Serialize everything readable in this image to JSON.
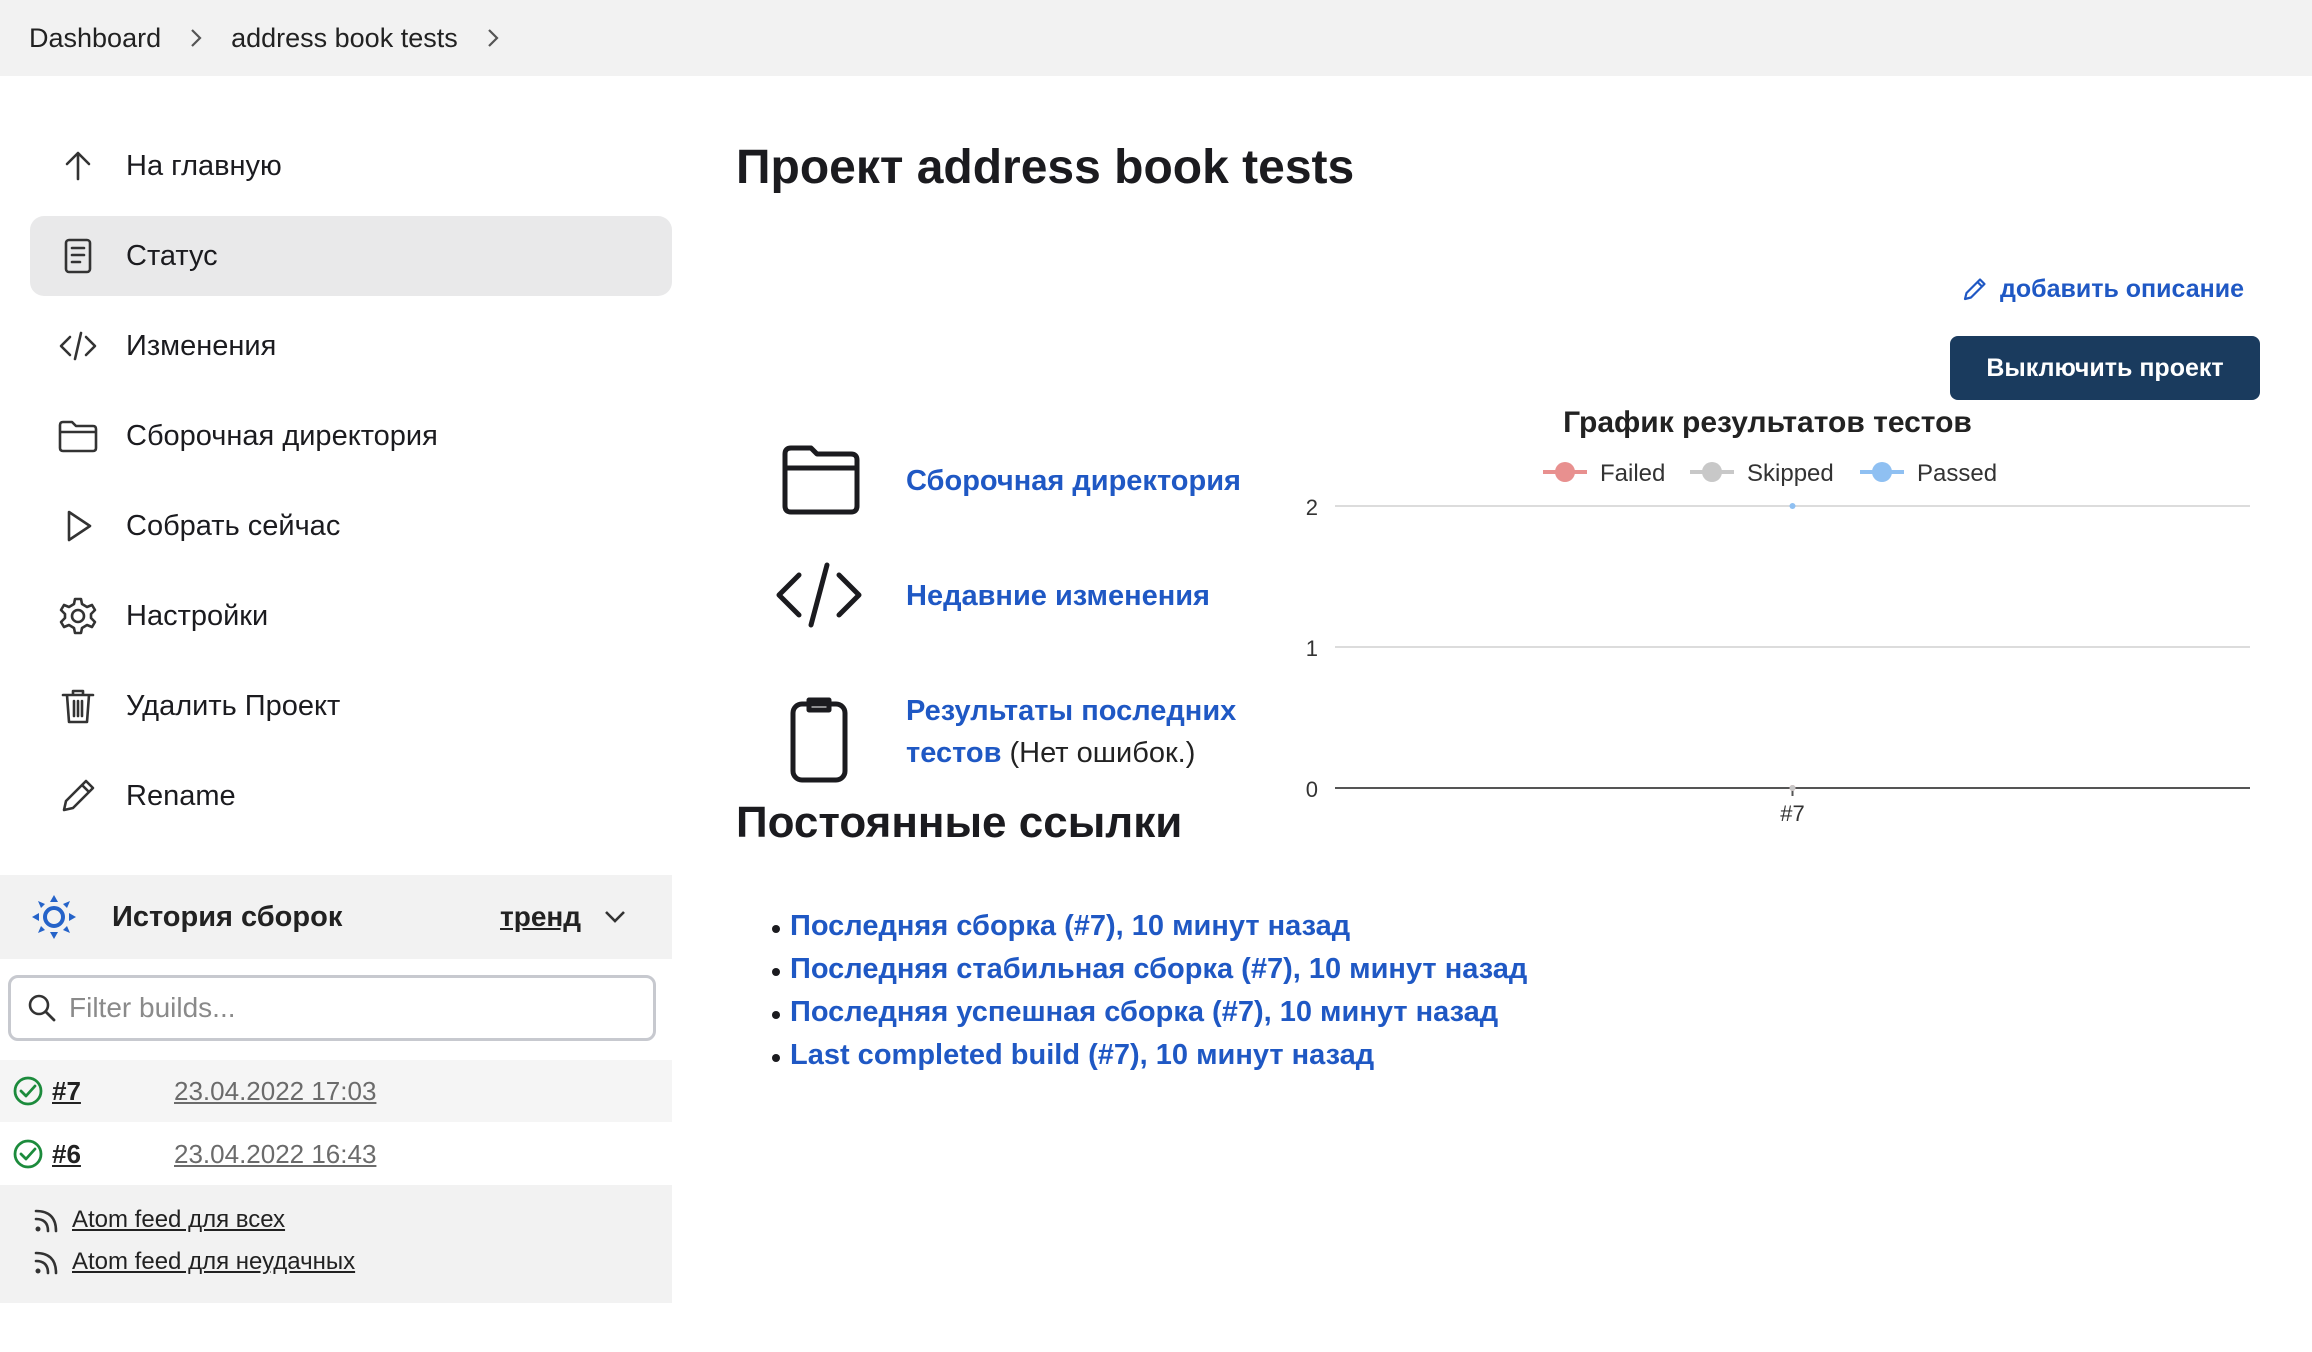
{
  "breadcrumb": {
    "items": [
      "Dashboard",
      "address book tests"
    ]
  },
  "sidebar": {
    "items": [
      {
        "label": "На главную",
        "icon": "arrow-up-icon"
      },
      {
        "label": "Статус",
        "icon": "document-icon",
        "active": true
      },
      {
        "label": "Изменения",
        "icon": "code-icon"
      },
      {
        "label": "Сборочная директория",
        "icon": "folder-icon"
      },
      {
        "label": "Собрать сейчас",
        "icon": "play-icon"
      },
      {
        "label": "Настройки",
        "icon": "gear-icon"
      },
      {
        "label": "Удалить Проект",
        "icon": "trash-icon"
      },
      {
        "label": "Rename",
        "icon": "pencil-icon"
      }
    ]
  },
  "build_history": {
    "title": "История сборок",
    "trend_label": "тренд",
    "filter_placeholder": "Filter builds...",
    "builds": [
      {
        "number": "#7",
        "date": "23.04.2022 17:03",
        "status": "success"
      },
      {
        "number": "#6",
        "date": "23.04.2022 16:43",
        "status": "success"
      }
    ],
    "feeds": [
      "Atom feed для всех",
      "Atom feed для неудачных"
    ]
  },
  "main": {
    "title": "Проект address book tests",
    "add_description": "добавить описание",
    "disable_button": "Выключить проект",
    "links": {
      "workspace": "Сборочная директория",
      "changes": "Недавние изменения",
      "test_results": "Результаты последних тестов",
      "test_results_note": "(Нет ошибок.)"
    },
    "permalinks_title": "Постоянные ссылки",
    "permalinks": [
      "Последняя сборка (#7), 10 минут назад",
      "Последняя стабильная сборка (#7), 10 минут назад",
      "Последняя успешная сборка (#7), 10 минут назад",
      "Last completed build (#7), 10 минут назад"
    ]
  },
  "colors": {
    "link": "#1f58c4",
    "button": "#1a3b5e",
    "failed": "#e8908f",
    "skipped": "#c8c8c8",
    "passed": "#8fc0f2"
  },
  "chart_data": {
    "type": "line",
    "title": "График результатов тестов",
    "categories": [
      "#7"
    ],
    "series": [
      {
        "name": "Failed",
        "values": [
          0
        ],
        "color": "#e8908f"
      },
      {
        "name": "Skipped",
        "values": [
          0
        ],
        "color": "#c8c8c8"
      },
      {
        "name": "Passed",
        "values": [
          2
        ],
        "color": "#8fc0f2"
      }
    ],
    "ylim": [
      0,
      2
    ],
    "yticks": [
      "0",
      "1",
      "2"
    ],
    "grid": true,
    "legend": "top"
  }
}
